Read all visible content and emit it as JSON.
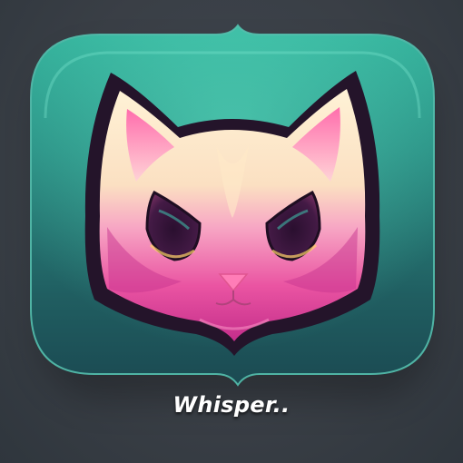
{
  "app": {
    "name": "Whisper.."
  },
  "icon": {
    "semantic": "cat-face-icon"
  },
  "colors": {
    "background": "#3a4149",
    "tile_light": "#2fae98",
    "tile_dark": "#1f5e60",
    "cat_cream": "#fbe7c3",
    "cat_pink": "#ef5fa4",
    "cat_magenta": "#c8358f",
    "outline": "#24142a",
    "nose": "#ff7db7",
    "label": "#ffffff"
  }
}
